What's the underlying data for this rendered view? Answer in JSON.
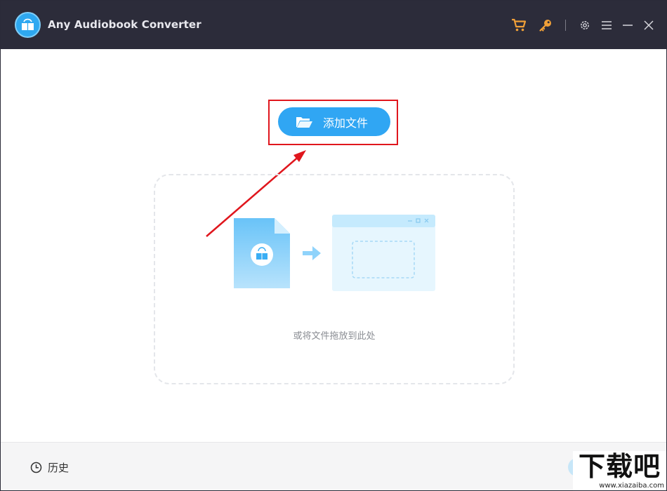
{
  "app": {
    "title": "Any Audiobook Converter",
    "icons": {
      "logo": "audiobook-logo",
      "cart": "cart-icon",
      "key": "key-icon",
      "settings": "gear-icon",
      "menu": "menu-icon",
      "minimize": "minimize-icon",
      "close": "close-icon"
    },
    "colors": {
      "titlebar": "#2c2c3a",
      "accent_orange": "#f0a038",
      "primary_blue": "#30a6f3",
      "highlight_red": "#e0161d"
    }
  },
  "main": {
    "add_button_label": "添加文件",
    "add_button_icon": "folder-open-icon",
    "drop_hint": "或将文件拖放到此处"
  },
  "footer": {
    "history_label": "历史",
    "history_icon": "clock-icon"
  },
  "watermark": {
    "logo_text": "下载吧",
    "url": "www.xiazaiba.com"
  }
}
